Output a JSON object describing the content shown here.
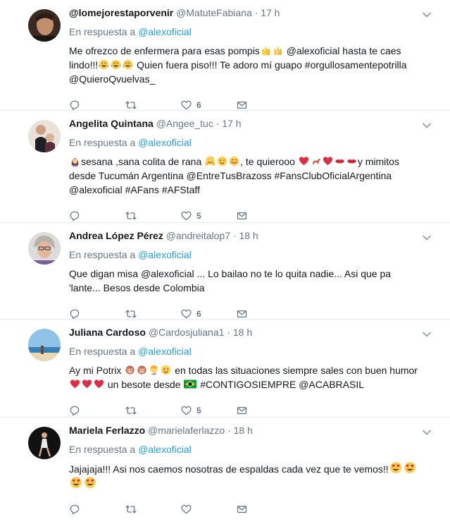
{
  "reply_prefix": "En respuesta a",
  "tweets": [
    {
      "name": "@lomejorestaporvenir",
      "handle": "@MatuteFabiana",
      "sep": "·",
      "time": "17 h",
      "reply_to": "@alexoficial",
      "text_a": "Me ofrezco de enfermera para esas pompis",
      "text_b": " @alexoficial hasta te caes lindo!!!",
      "text_c": " Quien fuera piso!!! Te adoro mí guapo #orgullosamentepotrilla @QuieroQvuelvas_",
      "emojis_a": [
        "raised-hands-emoji",
        "raised-hands-emoji"
      ],
      "emojis_b": [
        "tears-of-joy-emoji",
        "tears-of-joy-emoji",
        "tears-of-joy-emoji"
      ],
      "like_count": "6",
      "reply_count": "",
      "retweet_count": ""
    },
    {
      "name": "Angelita Quintana",
      "handle": "@Angee_tuc",
      "sep": "·",
      "time": "17 h",
      "reply_to": "@alexoficial",
      "text_a": "sesana ,sana colita de rana",
      "text_b": ", te quierooo",
      "text_c": "y mimitos desde Tucumán Argentina @EntreTusBrazoss #FansClubOficialArgentina @alexoficial #AFans #AFStaff",
      "like_count": "5"
    },
    {
      "name": "Andrea López Pérez",
      "handle": "@andreitalop7",
      "sep": "·",
      "time": "18 h",
      "reply_to": "@alexoficial",
      "text_a": "Que digan misa @alexoficial ... Lo bailao no te lo quita nadie... Asi que pa 'lante... Besos desde Colombia",
      "like_count": "6"
    },
    {
      "name": "Juliana Cardoso",
      "handle": "@Cardosjuliana1",
      "sep": "·",
      "time": "18 h",
      "reply_to": "@alexoficial",
      "text_a": "Ay mi Potrix",
      "text_b": " en todas las situaciones siempre sales con buen humor",
      "text_c": " un besote desde",
      "text_d": " #CONTIGOSIEMPRE @ACABRASIL",
      "like_count": "5"
    },
    {
      "name": "Mariela Ferlazzo",
      "handle": "@marielaferlazzo",
      "sep": "·",
      "time": "18 h",
      "reply_to": "@alexoficial",
      "text_a": "Jajajaja!!! Asi nos caemos nosotras de espaldas cada vez que te vemos!!",
      "like_count": ""
    }
  ],
  "colors": {
    "text": "#14171a",
    "muted": "#657786",
    "link": "#1da1f2",
    "border": "#e6ecf0"
  }
}
